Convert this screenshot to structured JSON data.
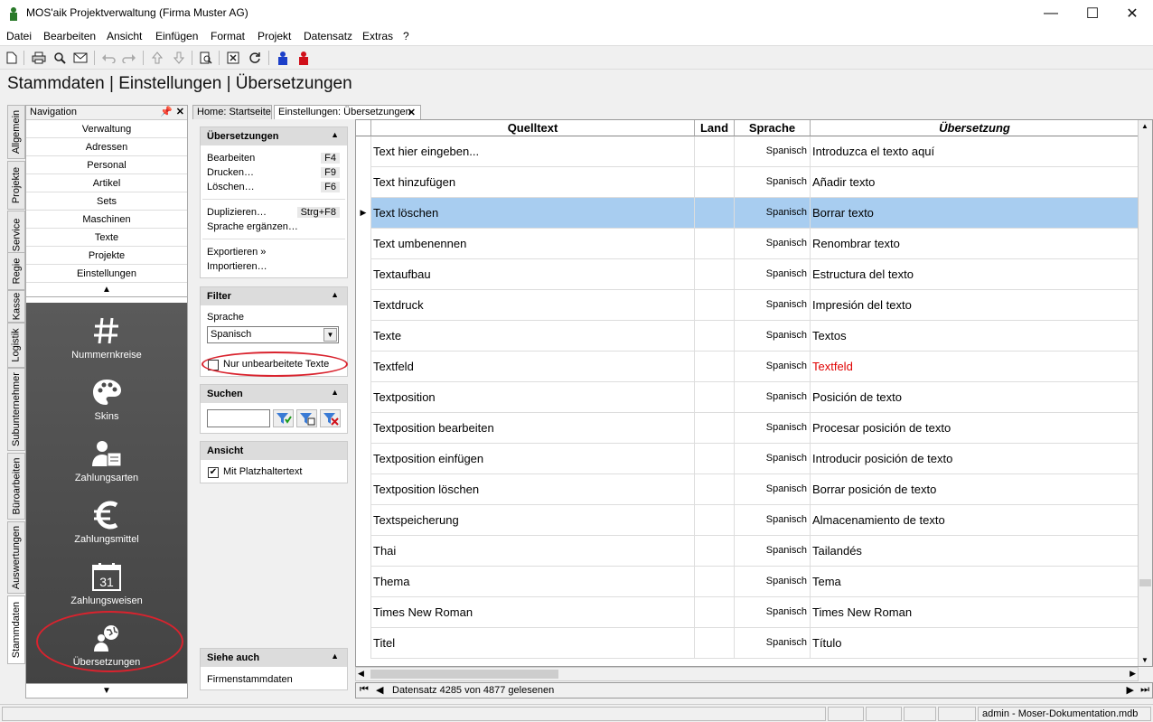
{
  "window": {
    "title": "MOS'aik Projektverwaltung (Firma Muster AG)",
    "minimize": "—",
    "maximize": "☐",
    "close": "✕"
  },
  "menu": [
    "Datei",
    "Bearbeiten",
    "Ansicht",
    "Einfügen",
    "Format",
    "Projekt",
    "Datensatz",
    "Extras",
    "?"
  ],
  "page_title": "Stammdaten | Einstellungen | Übersetzungen",
  "vertical_tabs": [
    "Allgemein",
    "Projekte",
    "Service",
    "Regie",
    "Kasse",
    "Logistik",
    "Subunternehmer",
    "Büroarbeiten",
    "Auswertungen",
    "Stammdaten"
  ],
  "navigation": {
    "title": "Navigation",
    "pin": "📌",
    "close": "✕",
    "buttons": [
      "Verwaltung",
      "Adressen",
      "Personal",
      "Artikel",
      "Sets",
      "Maschinen",
      "Texte",
      "Projekte",
      "Einstellungen"
    ],
    "up": "▲",
    "down": "▼",
    "big_items": [
      {
        "label": "Nummernkreise",
        "icon": "hash-icon"
      },
      {
        "label": "Skins",
        "icon": "palette-icon"
      },
      {
        "label": "Zahlungsarten",
        "icon": "payment-person-icon"
      },
      {
        "label": "Zahlungsmittel",
        "icon": "euro-icon"
      },
      {
        "label": "Zahlungsweisen",
        "icon": "calendar-icon"
      },
      {
        "label": "Übersetzungen",
        "icon": "translation-globe-icon"
      }
    ],
    "calendar_day": "31"
  },
  "doc_tabs": [
    "Home: Startseite",
    "Einstellungen: Übersetzungen"
  ],
  "tasks": {
    "uebersetzungen": {
      "title": "Übersetzungen",
      "items": [
        {
          "label": "Bearbeiten",
          "shortcut": "F4"
        },
        {
          "label": "Drucken…",
          "shortcut": "F9"
        },
        {
          "label": "Löschen…",
          "shortcut": "F6"
        },
        {
          "label": "Duplizieren…",
          "shortcut": "Strg+F8"
        },
        {
          "label": "Sprache ergänzen…",
          "shortcut": ""
        },
        {
          "label": "Exportieren »",
          "shortcut": ""
        },
        {
          "label": "Importieren…",
          "shortcut": ""
        }
      ]
    },
    "filter": {
      "title": "Filter",
      "language_label": "Sprache",
      "language_value": "Spanisch",
      "only_unedited": "Nur unbearbeitete Texte"
    },
    "suchen": {
      "title": "Suchen",
      "value": ""
    },
    "ansicht": {
      "title": "Ansicht",
      "placeholder_text": "Mit Platzhaltertext"
    },
    "siehe_auch": {
      "title": "Siehe auch",
      "link": "Firmenstammdaten"
    }
  },
  "grid": {
    "columns": [
      "Quelltext",
      "Land",
      "Sprache",
      "Übersetzung"
    ],
    "selected_row": 2,
    "rows": [
      {
        "q": "Text hier eingeben...",
        "l": "",
        "s": "Spanisch",
        "u": "Introduzca el texto aquí",
        "red": false
      },
      {
        "q": "Text hinzufügen",
        "l": "",
        "s": "Spanisch",
        "u": "Añadir texto",
        "red": false
      },
      {
        "q": "Text löschen",
        "l": "",
        "s": "Spanisch",
        "u": "Borrar texto",
        "red": false
      },
      {
        "q": "Text umbenennen",
        "l": "",
        "s": "Spanisch",
        "u": "Renombrar texto",
        "red": false
      },
      {
        "q": "Textaufbau",
        "l": "",
        "s": "Spanisch",
        "u": "Estructura del texto",
        "red": false
      },
      {
        "q": "Textdruck",
        "l": "",
        "s": "Spanisch",
        "u": "Impresión del texto",
        "red": false
      },
      {
        "q": "Texte",
        "l": "",
        "s": "Spanisch",
        "u": "Textos",
        "red": false
      },
      {
        "q": "Textfeld",
        "l": "",
        "s": "Spanisch",
        "u": "Textfeld",
        "red": true
      },
      {
        "q": "Textposition",
        "l": "",
        "s": "Spanisch",
        "u": "Posición de texto",
        "red": false
      },
      {
        "q": "Textposition bearbeiten",
        "l": "",
        "s": "Spanisch",
        "u": "Procesar posición de texto",
        "red": false
      },
      {
        "q": "Textposition einfügen",
        "l": "",
        "s": "Spanisch",
        "u": "Introducir posición de texto",
        "red": false
      },
      {
        "q": "Textposition löschen",
        "l": "",
        "s": "Spanisch",
        "u": "Borrar posición de texto",
        "red": false
      },
      {
        "q": "Textspeicherung",
        "l": "",
        "s": "Spanisch",
        "u": "Almacenamiento de texto",
        "red": false
      },
      {
        "q": "Thai",
        "l": "",
        "s": "Spanisch",
        "u": "Tailandés",
        "red": false
      },
      {
        "q": "Thema",
        "l": "",
        "s": "Spanisch",
        "u": "Tema",
        "red": false
      },
      {
        "q": "Times New Roman",
        "l": "",
        "s": "Spanisch",
        "u": "Times New Roman",
        "red": false
      },
      {
        "q": "Titel",
        "l": "",
        "s": "Spanisch",
        "u": "Título",
        "red": false
      }
    ],
    "record_status": "Datensatz 4285 von 4877 gelesenen"
  },
  "status": {
    "user": "admin - Moser-Dokumentation.mdb"
  },
  "colors": {
    "selected_row": "#a8cdf0",
    "highlight_ellipse": "#d9232e",
    "untranslated": "#e00000"
  }
}
